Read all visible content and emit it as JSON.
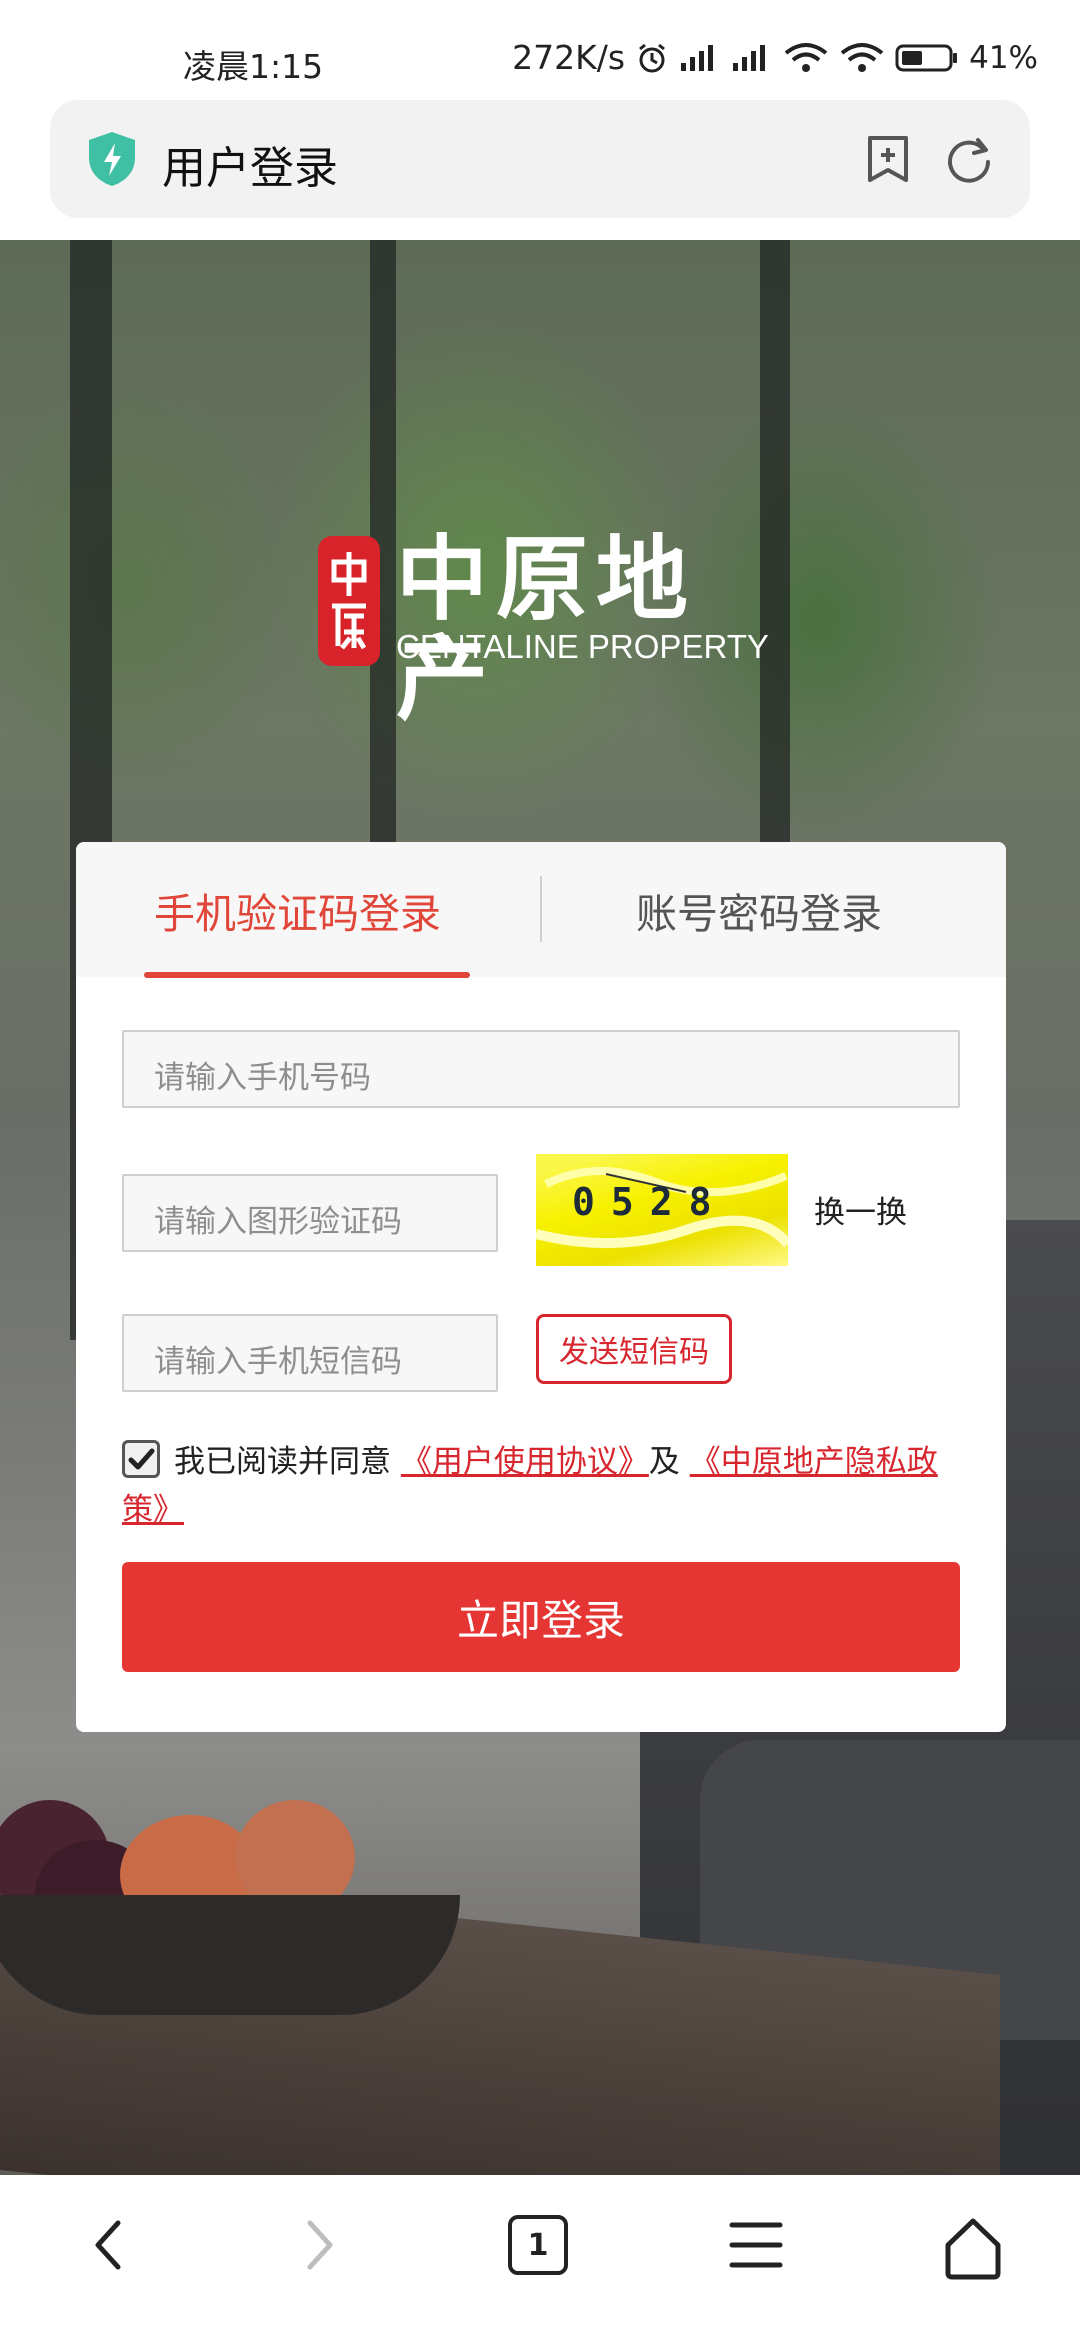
{
  "status_bar": {
    "time": "凌晨1:15",
    "network_speed": "272K/s",
    "battery": "41%"
  },
  "browser": {
    "page_title": "用户登录",
    "tab_count": "1"
  },
  "brand": {
    "name_cn": "中原地产",
    "name_en": "CENTALINE PROPERTY",
    "seal_text": "中原"
  },
  "login": {
    "tabs": [
      "手机验证码登录",
      "账号密码登录"
    ],
    "active_tab": 0,
    "phone_placeholder": "请输入手机号码",
    "captcha_placeholder": "请输入图形验证码",
    "captcha_code": "0528",
    "captcha_refresh": "换一换",
    "sms_placeholder": "请输入手机短信码",
    "sms_button": "发送短信码",
    "agree_prefix": "我已阅读并同意",
    "agreement_link": "《用户使用协议》",
    "agree_and": "及",
    "privacy_link": "《中原地产隐私政策》",
    "agree_checked": true,
    "submit": "立即登录"
  },
  "colors": {
    "accent": "#e0473a",
    "button": "#e63634",
    "link": "#d8262e",
    "captcha_bg": "#f7f100"
  },
  "icons": [
    "shield-icon",
    "bookmark-add-icon",
    "reload-icon",
    "back-icon",
    "forward-icon",
    "tabs-icon",
    "menu-icon",
    "home-icon",
    "alarm-icon",
    "signal-icon",
    "wifi-icon",
    "battery-icon"
  ]
}
